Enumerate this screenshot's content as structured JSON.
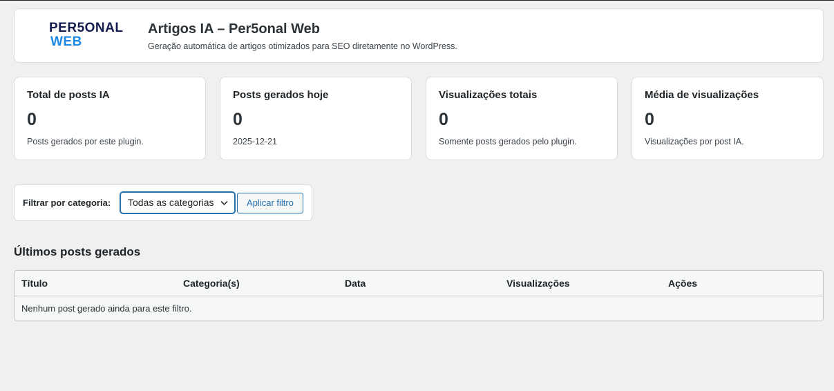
{
  "header": {
    "logo_top": "PER5ONAL",
    "logo_bottom": "WEB",
    "title": "Artigos IA – Per5onal Web",
    "subtitle": "Geração automática de artigos otimizados para SEO diretamente no WordPress."
  },
  "cards": [
    {
      "title": "Total de posts IA",
      "value": "0",
      "desc": "Posts gerados por este plugin."
    },
    {
      "title": "Posts gerados hoje",
      "value": "0",
      "desc": "2025-12-21"
    },
    {
      "title": "Visualizações totais",
      "value": "0",
      "desc": "Somente posts gerados pelo plugin."
    },
    {
      "title": "Média de visualizações",
      "value": "0",
      "desc": "Visualizações por post IA."
    }
  ],
  "filter": {
    "label": "Filtrar por categoria:",
    "selected": "Todas as categorias",
    "apply_label": "Aplicar filtro"
  },
  "posts": {
    "section_title": "Últimos posts gerados",
    "columns": [
      "Título",
      "Categoria(s)",
      "Data",
      "Visualizações",
      "Ações"
    ],
    "empty_message": "Nenhum post gerado ainda para este filtro."
  },
  "colors": {
    "accent": "#2271b1",
    "logo_dark": "#141c4f",
    "logo_blue": "#1e88e5"
  },
  "icons": {
    "select_arrow": "chevron-down-icon"
  }
}
